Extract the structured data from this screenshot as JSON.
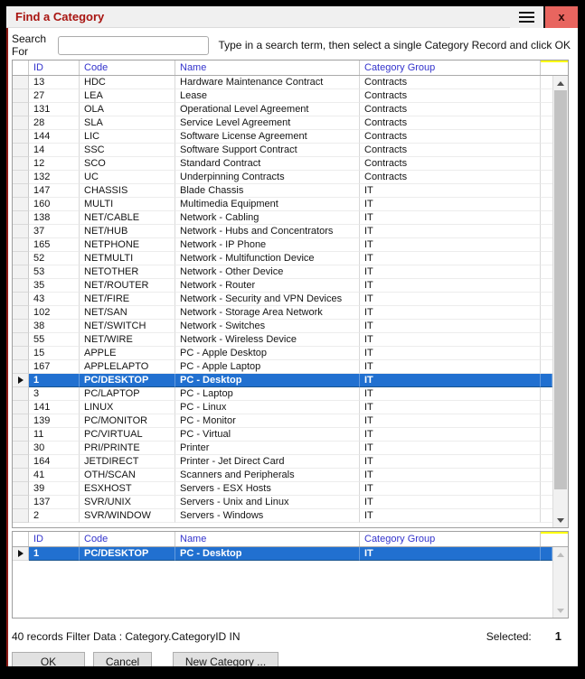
{
  "window": {
    "title": "Find a Category",
    "close_label": "x"
  },
  "search": {
    "label": "Search For",
    "value": "",
    "hint": "Type in a search term, then select a single Category Record and click OK"
  },
  "grid": {
    "columns": [
      "ID",
      "Code",
      "Name",
      "Category Group"
    ],
    "selected_index": 22,
    "rows": [
      [
        "13",
        "HDC",
        "Hardware Maintenance Contract",
        "Contracts"
      ],
      [
        "27",
        "LEA",
        "Lease",
        "Contracts"
      ],
      [
        "131",
        "OLA",
        "Operational Level Agreement",
        "Contracts"
      ],
      [
        "28",
        "SLA",
        "Service Level Agreement",
        "Contracts"
      ],
      [
        "144",
        "LIC",
        "Software License Agreement",
        "Contracts"
      ],
      [
        "14",
        "SSC",
        "Software Support Contract",
        "Contracts"
      ],
      [
        "12",
        "SCO",
        "Standard Contract",
        "Contracts"
      ],
      [
        "132",
        "UC",
        "Underpinning Contracts",
        "Contracts"
      ],
      [
        "147",
        "CHASSIS",
        "Blade Chassis",
        "IT"
      ],
      [
        "160",
        "MULTI",
        "Multimedia Equipment",
        "IT"
      ],
      [
        "138",
        "NET/CABLE",
        "Network - Cabling",
        "IT"
      ],
      [
        "37",
        "NET/HUB",
        "Network - Hubs and Concentrators",
        "IT"
      ],
      [
        "165",
        "NETPHONE",
        "Network - IP Phone",
        "IT"
      ],
      [
        "52",
        "NETMULTI",
        "Network - Multifunction Device",
        "IT"
      ],
      [
        "53",
        "NETOTHER",
        "Network - Other Device",
        "IT"
      ],
      [
        "35",
        "NET/ROUTER",
        "Network - Router",
        "IT"
      ],
      [
        "43",
        "NET/FIRE",
        "Network - Security and VPN Devices",
        "IT"
      ],
      [
        "102",
        "NET/SAN",
        "Network - Storage Area Network",
        "IT"
      ],
      [
        "38",
        "NET/SWITCH",
        "Network - Switches",
        "IT"
      ],
      [
        "55",
        "NET/WIRE",
        "Network - Wireless Device",
        "IT"
      ],
      [
        "15",
        "APPLE",
        "PC - Apple Desktop",
        "IT"
      ],
      [
        "167",
        "APPLELAPTO",
        "PC - Apple Laptop",
        "IT"
      ],
      [
        "1",
        "PC/DESKTOP",
        "PC - Desktop",
        "IT"
      ],
      [
        "3",
        "PC/LAPTOP",
        "PC - Laptop",
        "IT"
      ],
      [
        "141",
        "LINUX",
        "PC - Linux",
        "IT"
      ],
      [
        "139",
        "PC/MONITOR",
        "PC - Monitor",
        "IT"
      ],
      [
        "11",
        "PC/VIRTUAL",
        "PC - Virtual",
        "IT"
      ],
      [
        "30",
        "PRI/PRINTE",
        "Printer",
        "IT"
      ],
      [
        "164",
        "JETDIRECT",
        "Printer - Jet Direct Card",
        "IT"
      ],
      [
        "41",
        "OTH/SCAN",
        "Scanners and Peripherals",
        "IT"
      ],
      [
        "39",
        "ESXHOST",
        "Servers - ESX Hosts",
        "IT"
      ],
      [
        "137",
        "SVR/UNIX",
        "Servers - Unix and Linux",
        "IT"
      ],
      [
        "2",
        "SVR/WINDOW",
        "Servers - Windows",
        "IT"
      ]
    ]
  },
  "selection_grid": {
    "columns": [
      "ID",
      "Code",
      "Name",
      "Category Group"
    ],
    "selected_index": 0,
    "rows": [
      [
        "1",
        "PC/DESKTOP",
        "PC - Desktop",
        "IT"
      ]
    ]
  },
  "status": {
    "left": "40 records Filter Data : Category.CategoryID IN",
    "selected_label": "Selected:",
    "selected_count": "1"
  },
  "buttons": {
    "ok": "OK",
    "cancel": "Cancel",
    "new_category": "New Category ..."
  },
  "colors": {
    "title_text": "#a81410",
    "close_button": "#e8655f",
    "header_text": "#3333cc",
    "selected_row": "#2170d0",
    "accent_line": "#ffff00"
  }
}
